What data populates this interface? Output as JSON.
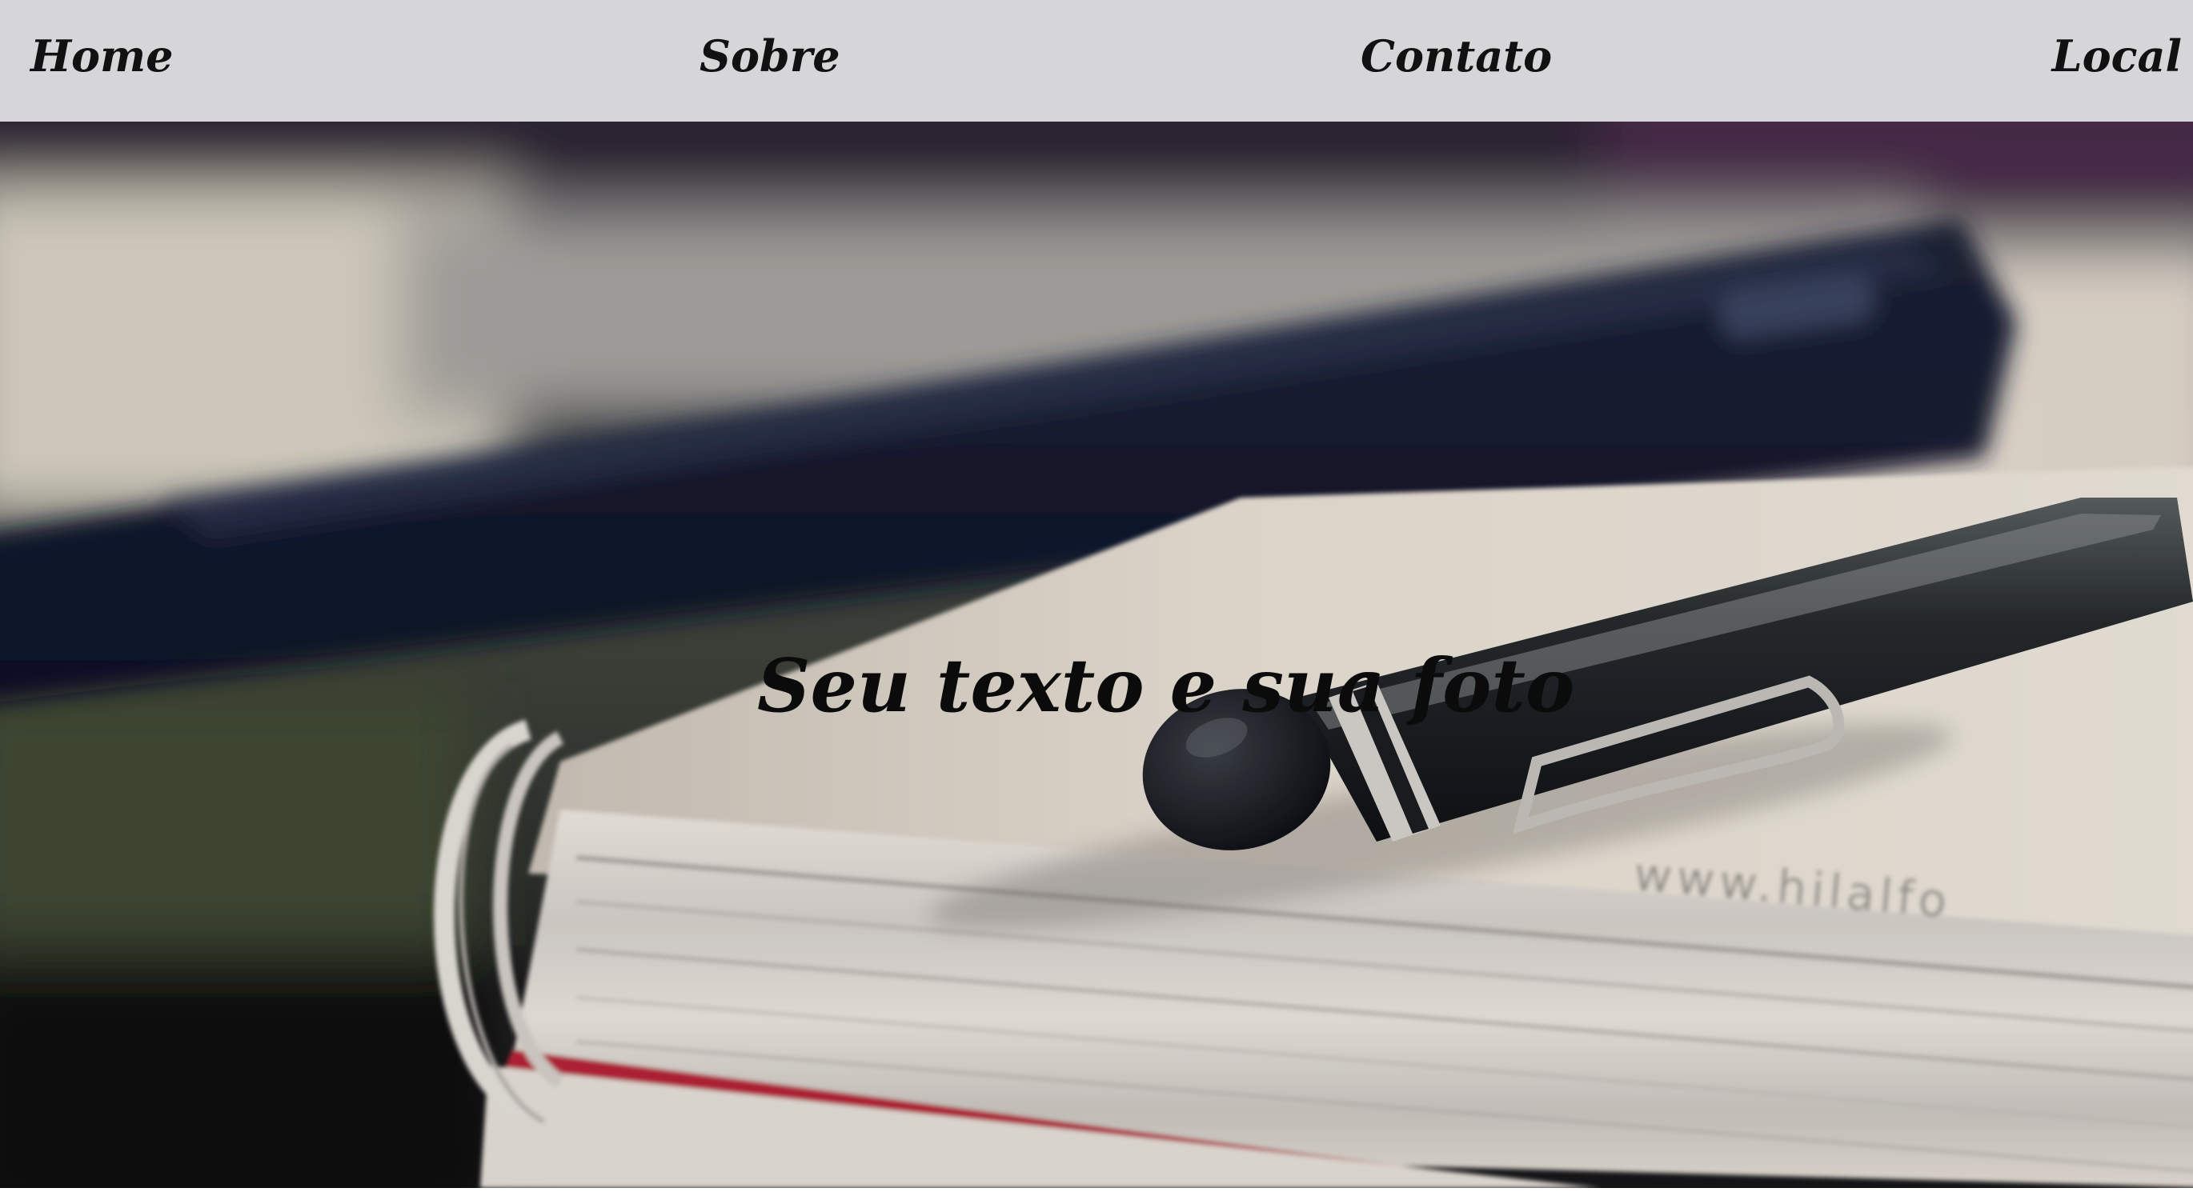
{
  "nav": {
    "items": [
      {
        "label": "Home"
      },
      {
        "label": "Sobre"
      },
      {
        "label": "Contato"
      },
      {
        "label": "Local"
      }
    ],
    "background": "#d6d6d8"
  },
  "hero": {
    "title": "Seu texto e sua foto",
    "notebook_imprint": "www.hilalfo"
  }
}
